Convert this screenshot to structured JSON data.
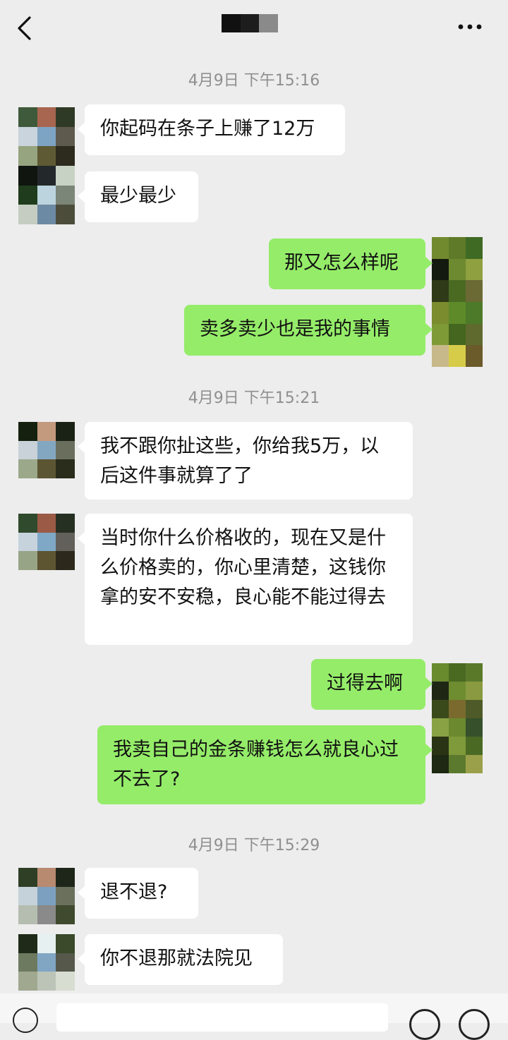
{
  "header": {
    "back_icon": "chevron-left-icon",
    "title": "",
    "more_icon": "more-dots-icon"
  },
  "messages": [
    {
      "type": "timestamp",
      "text": "4月9日 下午15:16"
    },
    {
      "type": "in",
      "text": "你起码在条子上赚了12万"
    },
    {
      "type": "in",
      "text": "最少最少"
    },
    {
      "type": "out",
      "text": "那又怎么样呢"
    },
    {
      "type": "out",
      "text": "卖多卖少也是我的事情"
    },
    {
      "type": "timestamp",
      "text": "4月9日 下午15:21"
    },
    {
      "type": "in",
      "text": "我不跟你扯这些，你给我5万，以后这件事就算了了"
    },
    {
      "type": "in",
      "text": "当时你什么价格收的，现在又是什么价格卖的，你心里清楚，这钱你拿的安不安稳，良心能不能过得去"
    },
    {
      "type": "out",
      "text": "过得去啊"
    },
    {
      "type": "out",
      "text": "我卖自己的金条赚钱怎么就良心过不去了?"
    },
    {
      "type": "timestamp",
      "text": "4月9日 下午15:29"
    },
    {
      "type": "in",
      "text": "退不退?"
    },
    {
      "type": "in",
      "text": "你不退那就法院见"
    }
  ],
  "input_bar": {
    "voice_icon": "voice-icon",
    "emoji_icon": "emoji-icon",
    "plus_icon": "plus-icon"
  },
  "colors": {
    "background": "#ededed",
    "outgoing_bubble": "#95ec69",
    "incoming_bubble": "#ffffff",
    "timestamp_text": "#8f8f8f"
  }
}
